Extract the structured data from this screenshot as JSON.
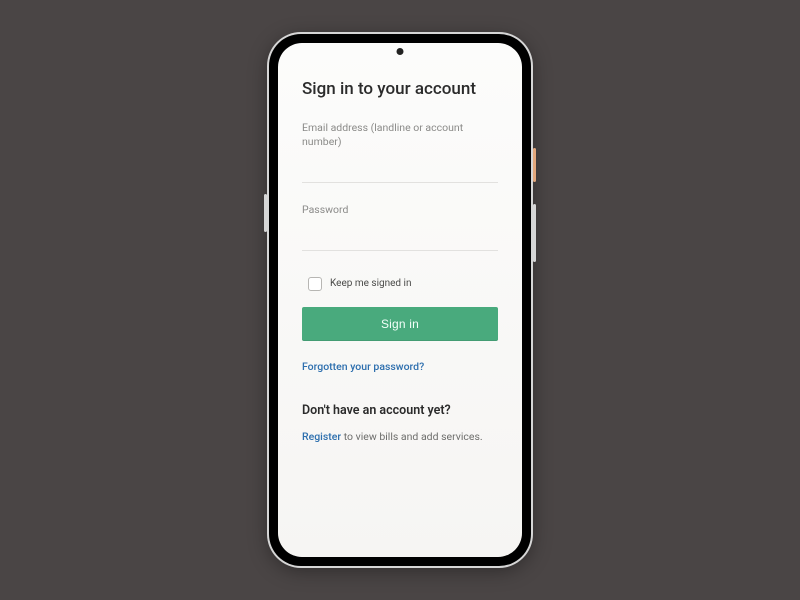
{
  "title": "Sign in to your account",
  "email": {
    "label": "Email address (landline or account number)",
    "value": ""
  },
  "password": {
    "label": "Password",
    "value": ""
  },
  "keep_signed_in_label": "Keep me signed in",
  "signin_button": "Sign in",
  "forgot_password": "Forgotten your password?",
  "no_account_heading": "Don't have an account yet?",
  "register_link": "Register",
  "register_tail": " to view bills and add services.",
  "colors": {
    "primary_button": "#49aa7d",
    "link": "#2d6fae",
    "background": "#4a4545"
  }
}
